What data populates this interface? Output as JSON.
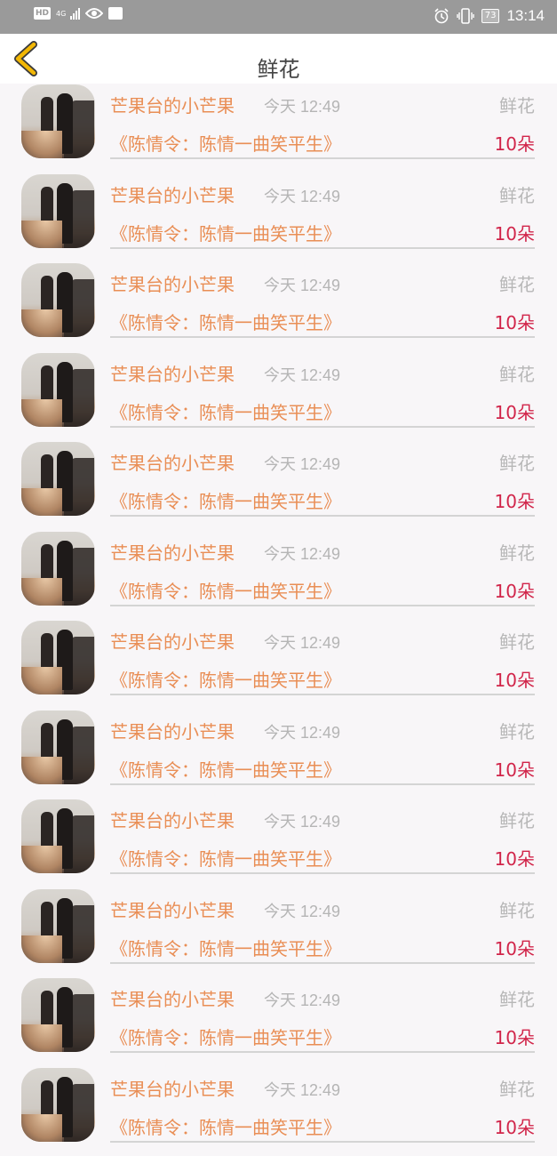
{
  "status_bar": {
    "network_hd": "HD",
    "network_type": "4G",
    "battery": "73",
    "time": "13:14"
  },
  "header": {
    "title": "鲜花"
  },
  "list": {
    "items": [
      {
        "name": "芒果台的小芒果",
        "time": "今天 12:49",
        "gift": "鲜花",
        "show": "《陈情令：陈情一曲笑平生》",
        "count": "10朵"
      },
      {
        "name": "芒果台的小芒果",
        "time": "今天 12:49",
        "gift": "鲜花",
        "show": "《陈情令：陈情一曲笑平生》",
        "count": "10朵"
      },
      {
        "name": "芒果台的小芒果",
        "time": "今天 12:49",
        "gift": "鲜花",
        "show": "《陈情令：陈情一曲笑平生》",
        "count": "10朵"
      },
      {
        "name": "芒果台的小芒果",
        "time": "今天 12:49",
        "gift": "鲜花",
        "show": "《陈情令：陈情一曲笑平生》",
        "count": "10朵"
      },
      {
        "name": "芒果台的小芒果",
        "time": "今天 12:49",
        "gift": "鲜花",
        "show": "《陈情令：陈情一曲笑平生》",
        "count": "10朵"
      },
      {
        "name": "芒果台的小芒果",
        "time": "今天 12:49",
        "gift": "鲜花",
        "show": "《陈情令：陈情一曲笑平生》",
        "count": "10朵"
      },
      {
        "name": "芒果台的小芒果",
        "time": "今天 12:49",
        "gift": "鲜花",
        "show": "《陈情令：陈情一曲笑平生》",
        "count": "10朵"
      },
      {
        "name": "芒果台的小芒果",
        "time": "今天 12:49",
        "gift": "鲜花",
        "show": "《陈情令：陈情一曲笑平生》",
        "count": "10朵"
      },
      {
        "name": "芒果台的小芒果",
        "time": "今天 12:49",
        "gift": "鲜花",
        "show": "《陈情令：陈情一曲笑平生》",
        "count": "10朵"
      },
      {
        "name": "芒果台的小芒果",
        "time": "今天 12:49",
        "gift": "鲜花",
        "show": "《陈情令：陈情一曲笑平生》",
        "count": "10朵"
      },
      {
        "name": "芒果台的小芒果",
        "time": "今天 12:49",
        "gift": "鲜花",
        "show": "《陈情令：陈情一曲笑平生》",
        "count": "10朵"
      },
      {
        "name": "芒果台的小芒果",
        "time": "今天 12:49",
        "gift": "鲜花",
        "show": "《陈情令：陈情一曲笑平生》",
        "count": "10朵"
      }
    ]
  },
  "icons": {
    "back": "chevron-left-icon",
    "alarm": "alarm-icon",
    "vibrate": "vibrate-icon",
    "eye": "eye-icon",
    "signal": "signal-icon",
    "battery": "battery-icon"
  },
  "colors": {
    "accent_orange": "#e98e55",
    "count_red": "#d1254a",
    "back_yellow": "#f2b705"
  }
}
